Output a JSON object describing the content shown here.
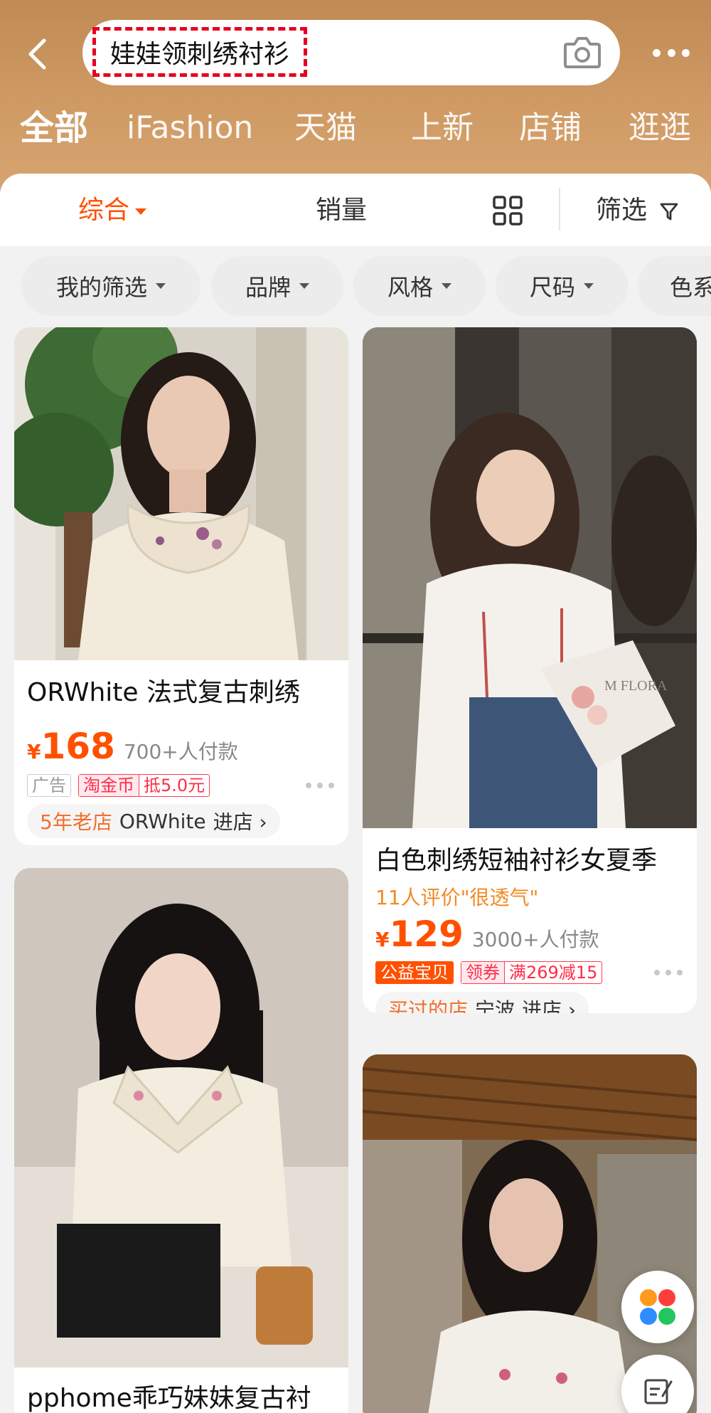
{
  "search": {
    "query": "娃娃领刺绣衬衫"
  },
  "scope_tabs": [
    "全部",
    "iFashion",
    "天猫",
    "上新",
    "店铺",
    "逛逛"
  ],
  "sort_bar": {
    "comprehensive": "综合",
    "sales": "销量",
    "filter": "筛选"
  },
  "filter_chips": [
    "我的筛选",
    "品牌",
    "风格",
    "尺码",
    "色系"
  ],
  "products": [
    {
      "title": "ORWhite 法式复古刺绣",
      "currency": "¥",
      "price": "168",
      "sales": "700+人付款",
      "tags": [
        "广告",
        "淘金币",
        "抵5.0元"
      ],
      "store_highlight": "5年老店",
      "store_name": "ORWhite",
      "store_action": "进店 ›"
    },
    {
      "title": "白色刺绣短袖衬衫女夏季",
      "review": "11人评价\"很透气\"",
      "currency": "¥",
      "price": "129",
      "sales": "3000+人付款",
      "tags": [
        "公益宝贝",
        "领券",
        "满269减15"
      ],
      "store_highlight": "买过的店",
      "store_name": "宁波",
      "store_action": "进店 ›"
    },
    {
      "title": "pphome乖巧妹妹复古衬"
    },
    {
      "title": ""
    }
  ],
  "photo_text": {
    "bouquet_wrap": "M FLORA"
  },
  "colors": {
    "accent": "#ff5000",
    "header": "#c8925c",
    "highlight_frame": "#e6001f"
  },
  "icons": [
    "back-arrow-icon",
    "camera-icon",
    "more-dots-icon",
    "grid-view-icon",
    "filter-funnel-icon",
    "app-grid-icon",
    "note-edit-icon"
  ]
}
